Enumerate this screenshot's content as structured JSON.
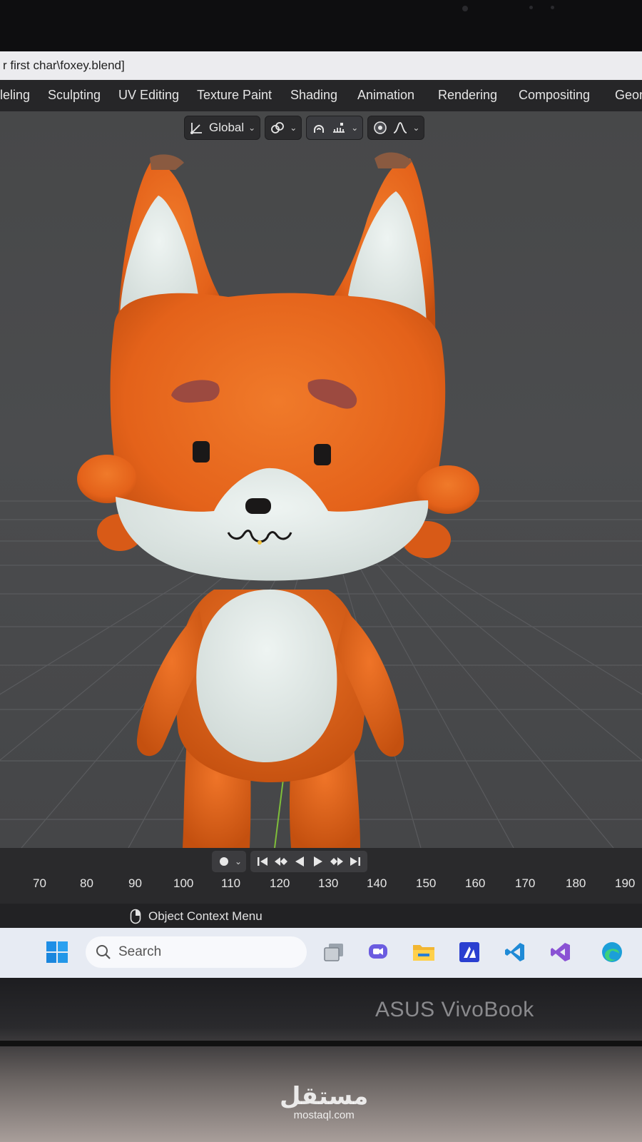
{
  "window": {
    "title": "r first char\\foxey.blend]"
  },
  "workspace_tabs": [
    "leling",
    "Sculpting",
    "UV Editing",
    "Texture Paint",
    "Shading",
    "Animation",
    "Rendering",
    "Compositing",
    "Geom"
  ],
  "header": {
    "transform_orientation": "Global"
  },
  "timeline": {
    "frames": [
      "70",
      "80",
      "90",
      "100",
      "110",
      "120",
      "130",
      "140",
      "150",
      "160",
      "170",
      "180",
      "190"
    ]
  },
  "status_bar": {
    "hint": "Object Context Menu"
  },
  "taskbar": {
    "search_placeholder": "Search",
    "apps": [
      "windows-start-icon",
      "task-view-icon",
      "teams-chat-icon",
      "file-explorer-icon",
      "mathworks-icon",
      "vscode-icon",
      "visual-studio-icon",
      "edge-icon"
    ]
  },
  "laptop": {
    "brand": "ASUS VivoBook"
  },
  "watermark": {
    "arabic": "مستقل",
    "latin": "mostaql.com"
  },
  "colors": {
    "fox_orange": "#e8651a",
    "fox_white": "#e3ecea",
    "viewport_bg": "#4a4b4d",
    "blender_header": "#262628"
  }
}
